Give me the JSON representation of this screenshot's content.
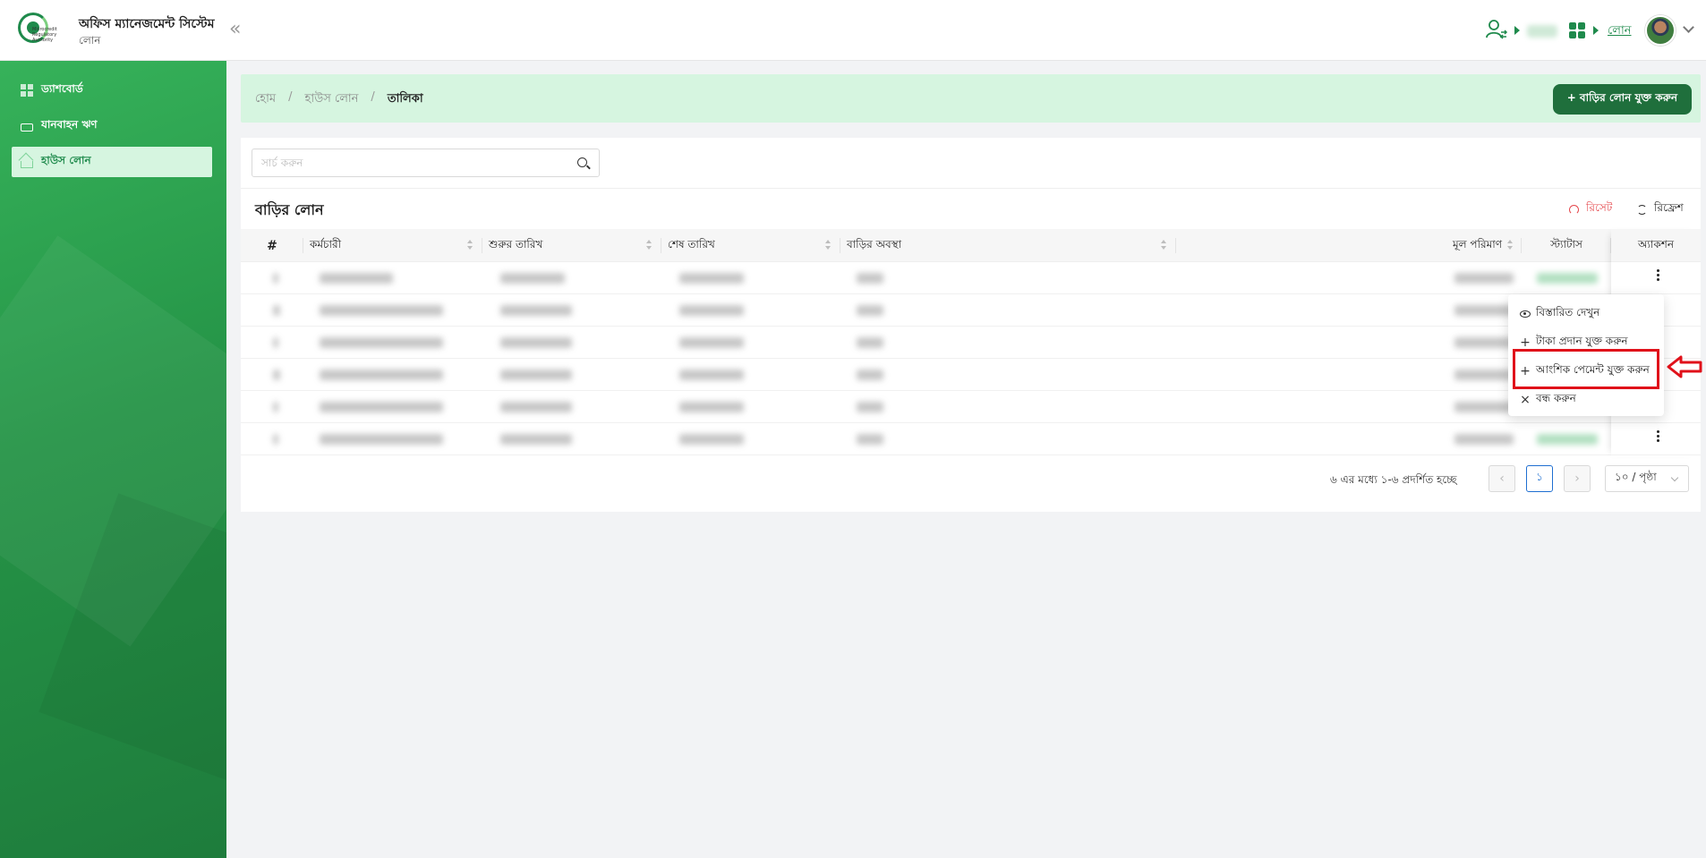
{
  "header": {
    "logo_text": "Microcredit Regulatory Authority",
    "app_title": "অফিস ম্যানেজমেন্ট সিস্টেম",
    "app_subtitle": "লোন",
    "collapse_label": "«",
    "module_link": "লোন"
  },
  "sidebar": {
    "items": [
      {
        "label": "ড্যাশবোর্ড",
        "icon": "dashboard-icon",
        "active": false
      },
      {
        "label": "যানবাহন ঋণ",
        "icon": "car-icon",
        "active": false
      },
      {
        "label": "হাউস লোন",
        "icon": "home-icon",
        "active": true
      }
    ]
  },
  "breadcrumb": {
    "items": [
      "হোম",
      "হাউস লোন",
      "তালিকা"
    ],
    "separator": "/"
  },
  "add_button": "+ বাড়ির লোন যুক্ত করুন",
  "search": {
    "placeholder": "সার্চ করুন",
    "value": ""
  },
  "table": {
    "title": "বাড়ির লোন",
    "reset_label": "রিসেট",
    "refresh_label": "রিফ্রেশ",
    "columns": [
      "#",
      "কর্মচারী",
      "শুরুর তারিখ",
      "শেষ তারিখ",
      "বাড়ির অবস্থা",
      "মূল পরিমাণ",
      "স্ট্যাটাস",
      "অ্যাকশন"
    ],
    "rows_count_visible": 6
  },
  "dropdown": {
    "items": [
      {
        "label": "বিস্তারিত দেখুন",
        "icon": "eye-icon"
      },
      {
        "label": "টাকা প্রদান যুক্ত করুন",
        "icon": "plus-icon"
      },
      {
        "label": "আংশিক পেমেন্ট যুক্ত করুন",
        "icon": "plus-icon"
      },
      {
        "label": "বন্ধ করুন",
        "icon": "close-icon"
      }
    ]
  },
  "pagination": {
    "summary": "৬ এর মধ্যে ১-৬ প্রদর্শিত হচ্ছে",
    "current_page": "১",
    "page_size": "১০ / পৃষ্ঠা",
    "prev": "‹",
    "next": "›"
  },
  "colors": {
    "brand_green": "#1f8a4c",
    "highlight_red": "#e0111a",
    "breadcrumb_bg": "#d6f5e0"
  }
}
